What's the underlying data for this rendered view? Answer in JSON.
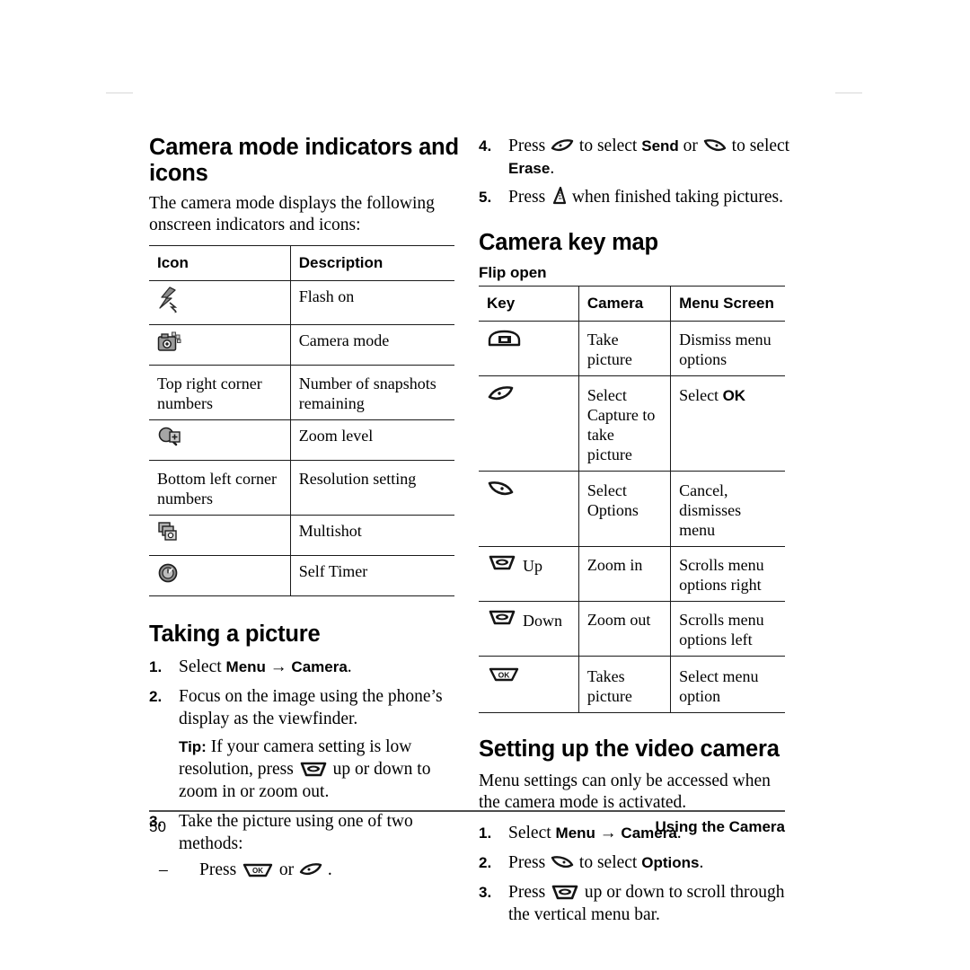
{
  "document": {
    "page_number": "50",
    "running_head": "Using the Camera"
  },
  "left_column": {
    "heading": "Camera mode indicators and icons",
    "intro": "The camera mode displays the following onscreen indicators and icons:",
    "indicator_table": {
      "headers": [
        "Icon",
        "Description"
      ],
      "rows": [
        {
          "icon": "flash-on-icon",
          "icon_text": "",
          "description": "Flash on"
        },
        {
          "icon": "camera-mode-icon",
          "icon_text": "",
          "description": "Camera mode"
        },
        {
          "icon": "",
          "icon_text": "Top right corner numbers",
          "description": "Number of snapshots remaining"
        },
        {
          "icon": "zoom-level-icon",
          "icon_text": "",
          "description": "Zoom level"
        },
        {
          "icon": "",
          "icon_text": "Bottom left corner numbers",
          "description": "Resolution setting"
        },
        {
          "icon": "multishot-icon",
          "icon_text": "",
          "description": "Multishot"
        },
        {
          "icon": "self-timer-icon",
          "icon_text": "",
          "description": "Self Timer"
        }
      ]
    },
    "taking_picture": {
      "heading": "Taking a picture",
      "step1_pre": "Select ",
      "step1_menu": "Menu",
      "step1_arrow": "→",
      "step1_camera": "Camera",
      "step1_post": ".",
      "step2": "Focus on the image using the phone’s display as the viewfinder.",
      "tip_label": "Tip:",
      "tip_pre": "If your camera setting is low resolution, press ",
      "tip_post": " up or down to zoom in or zoom out.",
      "step3": "Take the picture using one of two methods:",
      "substep_dash": "–",
      "substep_pre": "Press ",
      "substep_mid": " or ",
      "substep_post": " ."
    }
  },
  "right_column": {
    "step4_num": "4.",
    "step4_pre": "Press ",
    "step4_mid": " to select ",
    "step4_send": "Send",
    "step4_or": " or ",
    "step4_tail": " to select ",
    "step4_erase": "Erase",
    "step4_end": ".",
    "step5_num": "5.",
    "step5_pre": "Press ",
    "step5_post": " when finished taking pictures.",
    "keymap": {
      "heading": "Camera key map",
      "subheading": "Flip open",
      "headers": [
        "Key",
        "Camera",
        "Menu Screen"
      ],
      "rows": [
        {
          "key_icon": "camera-key-icon",
          "key_label": "",
          "camera": "Take picture",
          "menu_screen": "Dismiss menu options"
        },
        {
          "key_icon": "left-softkey-icon",
          "key_label": "",
          "camera": "Select Capture to take picture",
          "menu_screen_pre": "Select ",
          "menu_screen_bold": "OK"
        },
        {
          "key_icon": "right-softkey-icon",
          "key_label": "",
          "camera": "Select Options",
          "menu_screen": "Cancel, dismisses menu"
        },
        {
          "key_icon": "nav-key-icon",
          "key_label": "Up",
          "camera": "Zoom in",
          "menu_screen": "Scrolls menu options right"
        },
        {
          "key_icon": "nav-key-icon",
          "key_label": "Down",
          "camera": "Zoom out",
          "menu_screen": "Scrolls menu options left"
        },
        {
          "key_icon": "ok-key-icon",
          "key_label": "",
          "camera": "Takes picture",
          "menu_screen": "Select menu option"
        }
      ]
    },
    "video_camera": {
      "heading": "Setting up the video camera",
      "intro": "Menu settings can only be accessed when the camera mode is activated.",
      "step1_pre": "Select ",
      "step1_menu": "Menu",
      "step1_arrow": "→",
      "step1_camera": "Camera",
      "step1_post": ".",
      "step2_pre": "Press ",
      "step2_mid": " to select ",
      "step2_options": "Options",
      "step2_post": ".",
      "step3_pre": "Press ",
      "step3_post": " up or down to scroll through the vertical menu bar."
    }
  },
  "step_numbers": {
    "one": "1.",
    "two": "2.",
    "three": "3."
  },
  "colors": {
    "rule": "#1a1a1a",
    "footer_rule": "#4d4d4d",
    "icon_gray": "#808080",
    "icon_dark": "#333333"
  }
}
